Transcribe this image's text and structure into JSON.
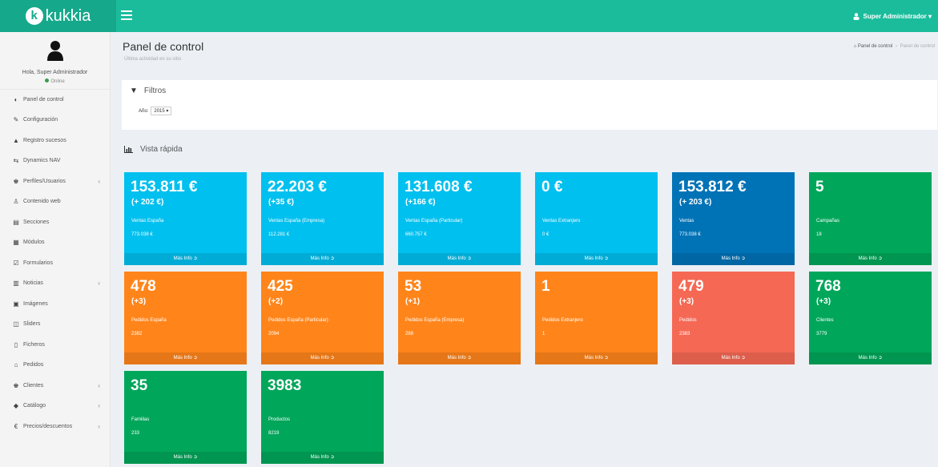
{
  "brand": {
    "name": "kukkia",
    "initial": "k"
  },
  "topbar": {
    "user": "Super Administrador ▾"
  },
  "sidebar": {
    "greeting": "Hola, Super Administrador",
    "status": "Online",
    "items": [
      {
        "label": "Panel de control",
        "icon": "dashboard-icon",
        "glyph": "◐",
        "chevron": ""
      },
      {
        "label": "Configuración",
        "icon": "wrench-icon",
        "glyph": "✎",
        "chevron": ""
      },
      {
        "label": "Registro sucesos",
        "icon": "warning-icon",
        "glyph": "▲",
        "chevron": ""
      },
      {
        "label": "Dynamics NAV",
        "icon": "exchange-icon",
        "glyph": "⇆",
        "chevron": ""
      },
      {
        "label": "Perfiles/Usuarios",
        "icon": "users-icon",
        "glyph": "♚",
        "chevron": "‹"
      },
      {
        "label": "Contenido web",
        "icon": "sitemap-icon",
        "glyph": "♙",
        "chevron": ""
      },
      {
        "label": "Secciones",
        "icon": "sections-icon",
        "glyph": "▤",
        "chevron": ""
      },
      {
        "label": "Módulos",
        "icon": "modules-icon",
        "glyph": "▦",
        "chevron": ""
      },
      {
        "label": "Formularios",
        "icon": "forms-icon",
        "glyph": "☑",
        "chevron": ""
      },
      {
        "label": "Noticias",
        "icon": "news-icon",
        "glyph": "▥",
        "chevron": "‹"
      },
      {
        "label": "Imágenes",
        "icon": "image-icon",
        "glyph": "▣",
        "chevron": ""
      },
      {
        "label": "Sliders",
        "icon": "slider-icon",
        "glyph": "◫",
        "chevron": ""
      },
      {
        "label": "Ficheros",
        "icon": "file-icon",
        "glyph": "▯",
        "chevron": ""
      },
      {
        "label": "Pedidos",
        "icon": "cart-icon",
        "glyph": "⌂",
        "chevron": ""
      },
      {
        "label": "Clientes",
        "icon": "clients-icon",
        "glyph": "♚",
        "chevron": "‹"
      },
      {
        "label": "Catálogo",
        "icon": "catalog-icon",
        "glyph": "◆",
        "chevron": "‹"
      },
      {
        "label": "Precios/descuentos",
        "icon": "euro-icon",
        "glyph": "€",
        "chevron": "‹"
      }
    ]
  },
  "header": {
    "title": "Panel de control",
    "subtitle": "Última actividad en su sitio",
    "breadcrumb": {
      "home": "Panel de control",
      "sep": "›",
      "current": "Panel de control"
    }
  },
  "filters": {
    "title": "Filtros",
    "year_label": "Año",
    "year_value": "2015 ▾"
  },
  "quick": {
    "title": "Vista rápida"
  },
  "boxes": [
    {
      "value": "153.811 €",
      "delta": "(+ 202 €)",
      "label": "Ventas España",
      "sub": "773.038 €",
      "foot": "Más Info ➲",
      "color": "#00c0ef"
    },
    {
      "value": "22.203 €",
      "delta": "(+35 €)",
      "label": "Ventas España (Empresa)",
      "sub": "112.281 €",
      "foot": "Más Info ➲",
      "color": "#00c0ef"
    },
    {
      "value": "131.608 €",
      "delta": "(+166 €)",
      "label": "Ventas España (Particular)",
      "sub": "660.757 €",
      "foot": "Más Info ➲",
      "color": "#00c0ef"
    },
    {
      "value": "0 €",
      "delta": "",
      "label": "Ventas Extranjero",
      "sub": "0 €",
      "foot": "Más Info ➲",
      "color": "#00c0ef"
    },
    {
      "value": "153.812 €",
      "delta": "(+ 203 €)",
      "label": "Ventas",
      "sub": "773.038 €",
      "foot": "Más Info ➲",
      "color": "#0073b7"
    },
    {
      "value": "5",
      "delta": "",
      "label": "Campañas",
      "sub": "18",
      "foot": "Más Info ➲",
      "color": "#00a65a"
    },
    {
      "value": "478",
      "delta": "(+3)",
      "label": "Pedidos España",
      "sub": "2382",
      "foot": "Más Info ➲",
      "color": "#ff851b"
    },
    {
      "value": "425",
      "delta": "(+2)",
      "label": "Pedidos España (Particular)",
      "sub": "2094",
      "foot": "Más Info ➲",
      "color": "#ff851b"
    },
    {
      "value": "53",
      "delta": "(+1)",
      "label": "Pedidos España (Empresa)",
      "sub": "288",
      "foot": "Más Info ➲",
      "color": "#ff851b"
    },
    {
      "value": "1",
      "delta": "",
      "label": "Pedidos Extranjero",
      "sub": "1",
      "foot": "Más Info ➲",
      "color": "#ff851b"
    },
    {
      "value": "479",
      "delta": "(+3)",
      "label": "Pedidos",
      "sub": "2383",
      "foot": "Más Info ➲",
      "color": "#f56954"
    },
    {
      "value": "768",
      "delta": "(+3)",
      "label": "Clientes",
      "sub": "3779",
      "foot": "Más Info ➲",
      "color": "#00a65a"
    },
    {
      "value": "35",
      "delta": "",
      "label": "Familias",
      "sub": "233",
      "foot": "Más Info ➲",
      "color": "#00a65a"
    },
    {
      "value": "3983",
      "delta": "",
      "label": "Productos",
      "sub": "8219",
      "foot": "Más Info ➲",
      "color": "#00a65a"
    }
  ],
  "accent_colors": {
    "topbar": "#1abc9c",
    "purple_row": "#9b3fd1"
  }
}
